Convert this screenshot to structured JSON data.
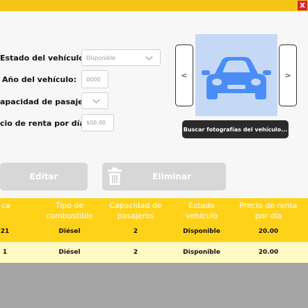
{
  "window": {
    "close_label": "X"
  },
  "form": {
    "estado_label": "Estado del vehículo:",
    "estado_value": "Disponible",
    "anio_label": "Año del vehículo:",
    "anio_placeholder": "0000",
    "capacidad_label": "apacidad de pasajeros:",
    "precio_label": "cio de renta por día:",
    "precio_placeholder": "$00.00"
  },
  "photo": {
    "prev_label": "<",
    "next_label": ">",
    "browse_label": "Buscar fotografías del vehículo..."
  },
  "actions": {
    "edit_label": "Editar",
    "delete_label": "Eliminar"
  },
  "table": {
    "headers": [
      "ca",
      "Tipo de combustible",
      "Capacidad de pasajeros",
      "Estado vehículo",
      "Precio de renta por día"
    ],
    "rows": [
      [
        "21",
        "Diésel",
        "2",
        "Disponible",
        "20.00"
      ],
      [
        "1",
        "Diésel",
        "2",
        "Disponible",
        "20.00"
      ]
    ]
  },
  "colors": {
    "accent_yellow": "#ffd21a",
    "row_highlight": "#ffd21a",
    "row_light": "#fff9c4",
    "close_red": "#d9262b",
    "car_blue": "#4a8ef5"
  }
}
